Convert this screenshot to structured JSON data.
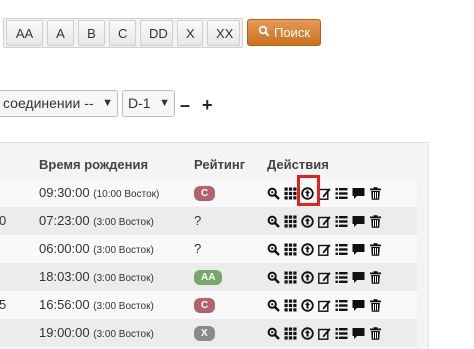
{
  "filters": [
    "AA",
    "A",
    "B",
    "C",
    "DD",
    "X",
    "XX"
  ],
  "search_label": "Поиск",
  "selects": {
    "connection": "соединении --",
    "d": "D-1"
  },
  "controls": {
    "minus": "–",
    "plus": "+"
  },
  "table": {
    "headers": {
      "time": "Время рождения",
      "rating": "Рейтинг",
      "actions": "Действия"
    },
    "rows": [
      {
        "left": "",
        "time": "09:30:00",
        "tz": "(10:00 Восток)",
        "rating": "C",
        "rating_color": "#b5636a"
      },
      {
        "left": "0",
        "time": "07:23:00",
        "tz": "(3:00 Восток)",
        "rating": "?",
        "rating_color": ""
      },
      {
        "left": "",
        "time": "06:00:00",
        "tz": "(3:00 Восток)",
        "rating": "?",
        "rating_color": ""
      },
      {
        "left": "",
        "time": "18:03:00",
        "tz": "(3:00 Восток)",
        "rating": "AA",
        "rating_color": "#78a86b"
      },
      {
        "left": "5",
        "time": "16:56:00",
        "tz": "(3:00 Восток)",
        "rating": "C",
        "rating_color": "#b5636a"
      },
      {
        "left": "",
        "time": "19:00:00",
        "tz": "(3:00 Восток)",
        "rating": "X",
        "rating_color": "#8a8a8a"
      }
    ]
  },
  "action_icons": [
    "zoom-icon",
    "grid-icon",
    "upload-circle-icon",
    "edit-icon",
    "list-icon",
    "comment-icon",
    "trash-icon"
  ]
}
